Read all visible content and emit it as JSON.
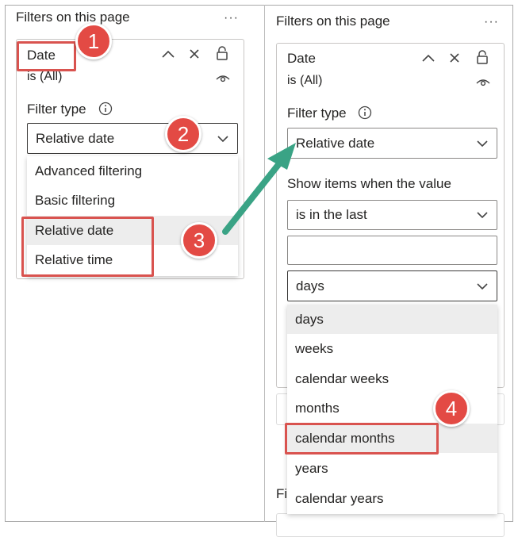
{
  "left_pane": {
    "title": "Filters on this page",
    "more_label": "···",
    "card": {
      "field_name": "Date",
      "field_status": "is (All)",
      "filter_type_label": "Filter type",
      "filter_type_value": "Relative date",
      "menu_items": [
        "Advanced filtering",
        "Basic filtering",
        "Relative date",
        "Relative time"
      ]
    }
  },
  "right_pane": {
    "title": "Filters on this page",
    "more_label": "···",
    "peek_label": "Fi",
    "card": {
      "field_name": "Date",
      "field_status": "is (All)",
      "filter_type_label": "Filter type",
      "filter_type_value": "Relative date",
      "show_items_label": "Show items when the value",
      "condition_value": "is in the last",
      "number_value": "",
      "unit_value": "days",
      "unit_options": [
        "days",
        "weeks",
        "calendar weeks",
        "months",
        "calendar months",
        "years",
        "calendar years"
      ]
    }
  },
  "badges": [
    "1",
    "2",
    "3",
    "4"
  ],
  "colors": {
    "badge": "#e34a44",
    "highlight_box": "#d9534f",
    "arrow": "#3aa385",
    "menu_highlight": "#ededed"
  },
  "icons": [
    "chevron-up-icon",
    "close-icon",
    "lock-icon",
    "eye-icon",
    "info-icon",
    "chevron-down-icon",
    "ellipsis-icon"
  ]
}
